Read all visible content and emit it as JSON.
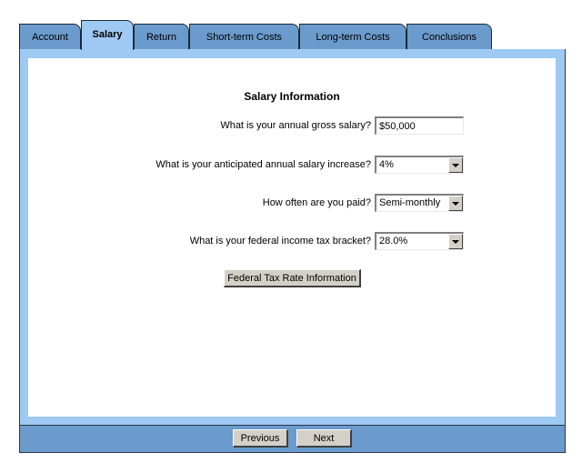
{
  "tabs": [
    {
      "label": "Account",
      "active": false
    },
    {
      "label": "Salary",
      "active": true
    },
    {
      "label": "Return",
      "active": false
    },
    {
      "label": "Short-term Costs",
      "active": false
    },
    {
      "label": "Long-term Costs",
      "active": false
    },
    {
      "label": "Conclusions",
      "active": false
    }
  ],
  "form": {
    "title": "Salary Information",
    "questions": {
      "salary": {
        "label": "What is your annual gross salary?",
        "value": "$50,000"
      },
      "increase": {
        "label": "What is your anticipated annual salary increase?",
        "value": "4%"
      },
      "frequency": {
        "label": "How often are you paid?",
        "value": "Semi-monthly"
      },
      "tax_bracket": {
        "label": "What is your federal income tax bracket?",
        "value": "28.0%"
      }
    },
    "tax_info_button": "Federal Tax Rate Information"
  },
  "footer": {
    "previous_label": "Previous",
    "next_label": "Next"
  },
  "colors": {
    "tab": "#6b9bcc",
    "active_tab": "#9ec9f2",
    "panel_border": "#9ec9f2",
    "footer": "#6b9bcc",
    "button_face": "#d4d0c8"
  }
}
